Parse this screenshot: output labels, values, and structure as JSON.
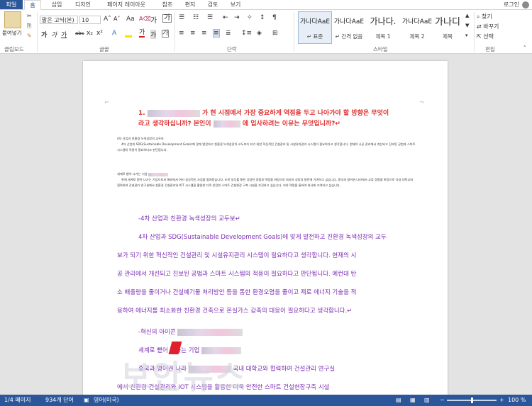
{
  "tabs": {
    "file": "파일",
    "home": "홈",
    "insert": "삽입",
    "design": "디자인",
    "layout": "페이지 레이아웃",
    "references": "참조",
    "mailings": "편지",
    "review": "검토",
    "view": "보기",
    "login": "로그인"
  },
  "ribbon": {
    "paste_label": "붙여넣기",
    "font_name": "맑은 고딕(본)",
    "font_size": "10",
    "aa_label": "Aa",
    "groups": {
      "clipboard": "클립보드",
      "font": "글꼴",
      "paragraph": "단락",
      "styles": "스타일",
      "editing": "편집"
    },
    "styles": [
      {
        "sample": "가나다AaE",
        "name": "↵ 표준"
      },
      {
        "sample": "가나다AaE",
        "name": "↵ 간격 없음"
      },
      {
        "sample": "가나다.",
        "name": "제목 1"
      },
      {
        "sample": "가나다AaE",
        "name": "제목 2"
      },
      {
        "sample": "가나디",
        "name": "제목"
      }
    ],
    "editing": {
      "find": "찾기",
      "replace": "바꾸기",
      "select": "선택"
    }
  },
  "document": {
    "heading_line1_prefix": "1.",
    "heading_line1_suffix": "가 현 시점에서 가장 중요하게 역점을 두고 나아가야 할 방향은 무엇이",
    "heading_line2_prefix": "라고 생각하십니까? 본인이",
    "heading_line2_suffix": "에 입사하려는 이유는 무엇입니까?↵",
    "small_para1_title": "4차 산업과 친환경 녹색성장의 교두보",
    "small_para1": "4차 산업과 SDG(Sustainable Development Goals)에 맞게 발전하고 친환경 녹색성장의 교두보가 되기 위한 혁신적인 건설관리 및 시설유지관리 시스템이 필요하다고 생각합니다. 현재의 시공 관리에서 개선되고 진보된 공법과 스마트 시스템의 적용이 필요하다고 판단됩니다.",
    "small_para2_title": "세계로 뻗어 나가는 기업",
    "small_para2": "현재 세계로 뻗어 나가는 기업으로서 해외에서 여러 성공적인 사업을 펼쳐왔습니다. 또한 실무를 통한 다양한 경험과 역량을 바탕으로 회사의 성장과 발전에 기여하고 싶습니다. 중국과 영어권 나라에서 교류 경험을 바탕으로 국내 대학교와 협력하여 건설관리 연구실에서 친환경 건설관리와 IOT 시스템을 활용한 더욱 안전한 스마트 건설현장 구축 시설을 추진하고 싶습니다. 저의 역량을 통하여 회사에 기여하고 싶습니다.",
    "p_title1": "-4차 산업과 친환경 녹색성장의 교두보↵",
    "p_body1": [
      "4차 산업과 SDG(Sustainable Development Goals)에 맞게 발전하고 친환경 녹색성장의 교두",
      "보가 되기 위한 혁신적인 건설관리 및 시설유지관리 시스템이 필요하다고 생각합니다. 현재의 시",
      "공 관리에서 개선되고 진보된 공법과 스마트 시스템의 적용이 필요하다고 판단됩니다. 예컨대 탄",
      "소 배출량을 줄이거나 건설폐기물 처리방안 등을 통한 환경오염을 줄이고 제로 에너지 기술을 적",
      "용하여 에너지를 최소화한 친환경 건축으로 온실가스 감축의 대응이 필요하다고 생각합니다.↵"
    ],
    "p_title2": "-혁신의 아이콘",
    "p_title3": "세계로 뻗어 나가는 기업",
    "p_body2": [
      "중국과 영어권 나라",
      "에서 친환경 건설관리와 IOT 시스템을 활용한 더욱 안전한 스마트 건설현장구축 시설"
    ],
    "p_body2_mid": "국내 대학교와 협력하여 건설관리 연구실"
  },
  "watermark": "보안뉴스",
  "status": {
    "page": "1/4 페이지",
    "words": "934개 단어",
    "language": "영어(미국)",
    "zoom": "100 %"
  },
  "colors": {
    "brand": "#2b579a",
    "heading_red": "#e03030",
    "body_purple": "#7b2bb3"
  }
}
